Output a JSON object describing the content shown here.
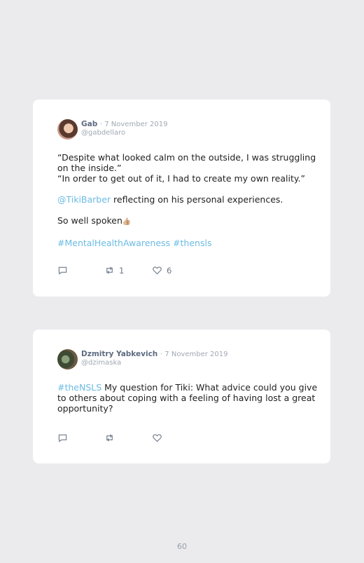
{
  "tweets": [
    {
      "name": "Gab",
      "date": "· 7 November 2019",
      "handle": "@gabdellaro",
      "quote_line1": "“Despite what looked calm on the outside, I was struggling",
      "quote_line2": "on the inside.”",
      "quote_line3": "“In order to get out of it, I had to create my own reality.”",
      "mention": "@TikiBarber",
      "mention_rest": " reflecting on his personal experiences.",
      "closing": "So well spoken",
      "closing_emoji": "👍🏼",
      "hashtags": "#MentalHealthAwareness #thensls",
      "retweets": "1",
      "likes": "6"
    },
    {
      "name": "Dzmitry Yabkevich",
      "date": "· 7 November 2019",
      "handle": "@dzimaska",
      "hashtag": "#theNSLS",
      "line1_rest": " My question for Tiki: What advice could you give",
      "line2": "to others about coping with a feeling of having lost a great",
      "line3": "opportunity?"
    }
  ],
  "page_number": "60"
}
